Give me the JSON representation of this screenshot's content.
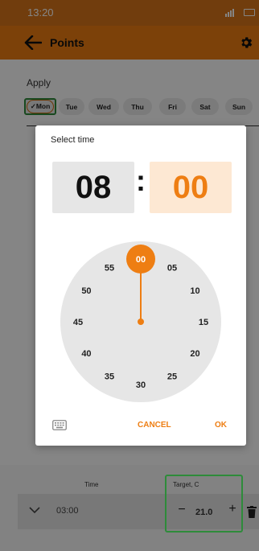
{
  "status": {
    "time": "13:20"
  },
  "appbar": {
    "title": "Points"
  },
  "apply": {
    "label": "Apply",
    "days": [
      {
        "label": "Mon",
        "selected": true
      },
      {
        "label": "Tue",
        "selected": false
      },
      {
        "label": "Wed",
        "selected": false
      },
      {
        "label": "Thu",
        "selected": false
      },
      {
        "label": "Fri",
        "selected": false
      },
      {
        "label": "Sat",
        "selected": false
      },
      {
        "label": "Sun",
        "selected": false
      }
    ],
    "check_mark": "✓"
  },
  "dialog": {
    "title": "Select time",
    "hour": "08",
    "separator": ":",
    "minute": "00",
    "clock_labels": [
      "00",
      "05",
      "10",
      "15",
      "20",
      "25",
      "30",
      "35",
      "40",
      "45",
      "50",
      "55"
    ],
    "selected_minute": "00",
    "cancel_label": "CANCEL",
    "ok_label": "OK"
  },
  "table": {
    "time_header": "Time",
    "target_header": "Target, C",
    "row": {
      "time": "03:00",
      "target": "21.0",
      "minus": "−",
      "plus": "+"
    }
  },
  "colors": {
    "accent": "#ee7e13",
    "status_bar": "#d9761a",
    "highlight_frame": "#2e8b3a"
  },
  "icons": [
    "back-arrow-icon",
    "gear-icon",
    "keyboard-icon",
    "chevron-down-icon",
    "trash-icon"
  ]
}
